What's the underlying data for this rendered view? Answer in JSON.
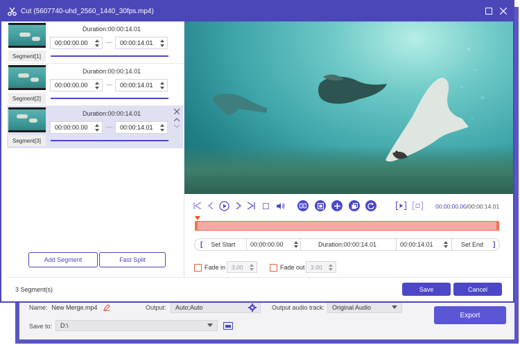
{
  "dialog": {
    "title": "Cut (5607740-uhd_2560_1440_30fps.mp4)",
    "icons": {
      "logo": "scissors-icon",
      "maximize": "maximize-icon",
      "close": "close-icon"
    }
  },
  "segments": [
    {
      "name": "Segment[1]",
      "duration": "Duration:00:00:14.01",
      "start": "00:00:00.00",
      "end": "00:00:14.01",
      "active": false
    },
    {
      "name": "Segment[2]",
      "duration": "Duration:00:00:14.01",
      "start": "00:00:00.00",
      "end": "00:00:14.01",
      "active": false
    },
    {
      "name": "Segment[3]",
      "duration": "Duration:00:00:14.01",
      "start": "00:00:00.00",
      "end": "00:00:14.01",
      "active": true
    }
  ],
  "left_buttons": {
    "add_segment": "Add Segment",
    "fast_split": "Fast Split"
  },
  "segment_count": "3 Segment(s)",
  "player": {
    "icons": [
      "skip-to-start-icon",
      "previous-frame-icon",
      "play-icon",
      "next-frame-icon",
      "skip-to-end-icon",
      "stop-icon",
      "volume-icon",
      "split-icon",
      "snapshot-icon",
      "add-segment-icon",
      "copy-icon",
      "reset-icon",
      "preview-segment-icon",
      "preview-others-icon"
    ],
    "current_time": "00:00:00.00",
    "total_time": "/00:00:14.01"
  },
  "range": {
    "set_start": "Set Start",
    "start_time": "00:00:00.00",
    "duration": "Duration:00:00:14.01",
    "end_time": "00:00:14.01",
    "set_end": "Set End"
  },
  "fade": {
    "in_label": "Fade in",
    "in_value": "3.00",
    "out_label": "Fade out",
    "out_value": "3.00"
  },
  "actions": {
    "save": "Save",
    "cancel": "Cancel"
  },
  "background": {
    "name_label": "Name:",
    "name_value": "New Merge.mp4",
    "output_label": "Output:",
    "output_value": "Auto;Auto",
    "audio_label": "Output audio track:",
    "audio_value": "Original Audio",
    "save_to_label": "Save to:",
    "save_to_value": "D:\\",
    "export": "Export"
  },
  "colors": {
    "accent": "#4b47c8",
    "timeline_fill": "#f4a9a4",
    "timeline_border": "#e96a5a",
    "active_row": "#e0e0f3"
  }
}
